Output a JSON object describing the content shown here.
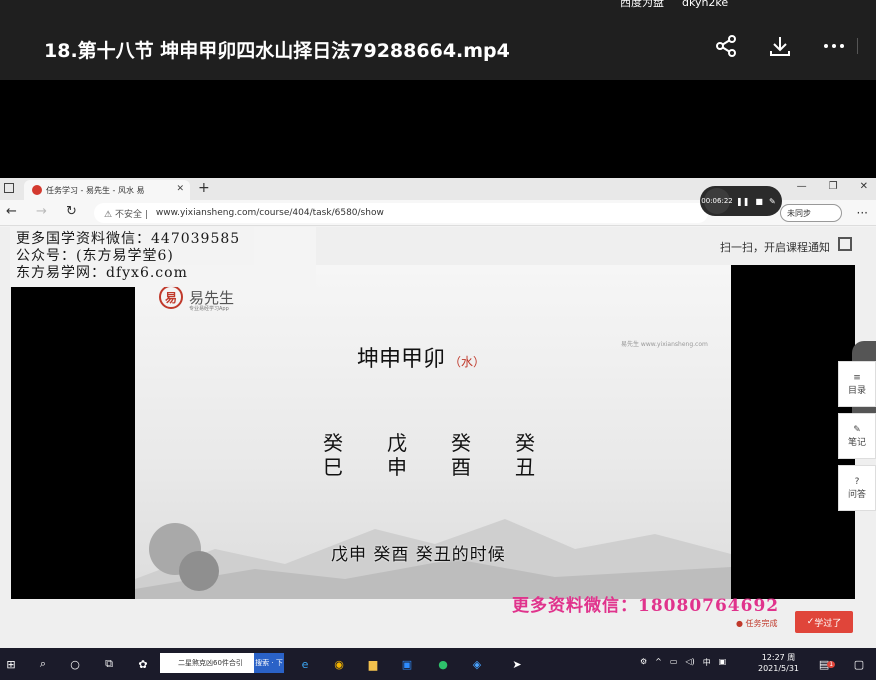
{
  "player": {
    "title": "18.第十八节 坤申甲卯四水山择日法79288664.mp4",
    "top_cut_text": "西度为盘 　 dkyh2ke",
    "icons": [
      "share-icon",
      "download-icon",
      "more-icon"
    ]
  },
  "browser": {
    "tab_title": "任务学习 - 易先生 - 风水 易",
    "insecure_label": "不安全",
    "url": "www.yixiansheng.com/course/404/task/6580/show",
    "recorder_time": "00:06:22",
    "sync_label": "未同步",
    "window_controls": [
      "—",
      "❐",
      "✕"
    ]
  },
  "page": {
    "ad_lines": [
      "更多国学资料微信：447039585",
      "公众号：(东方易学堂6)",
      "东方易学网：dfyx6.com"
    ],
    "scan_text": "扫一扫，开启课程通知",
    "slide": {
      "logo_name": "易先生",
      "logo_sub": "专业易经学习App",
      "title": "坤申甲卯",
      "title_sub": "（水）",
      "watermark": "易先生 www.yixiansheng.com",
      "ganzhi": [
        {
          "stem": "癸",
          "branch": "巳"
        },
        {
          "stem": "戊",
          "branch": "申"
        },
        {
          "stem": "癸",
          "branch": "酉"
        },
        {
          "stem": "癸",
          "branch": "丑"
        }
      ],
      "caption": "戊申  癸酉  癸丑的时候"
    },
    "side_tools": [
      {
        "icon": "menu-icon",
        "label": "目录"
      },
      {
        "icon": "note-icon",
        "label": "笔记"
      },
      {
        "icon": "question-icon",
        "label": "问答"
      }
    ],
    "wechat_ad": "更多资料微信：18080764692",
    "task_done": "任务完成",
    "learned_button": "学过了"
  },
  "taskbar": {
    "search_text": "二星煞克凶60件合引",
    "search_go": "搜索 · 下",
    "ime": "中",
    "time": "12:27 周",
    "date": "2021/5/31",
    "notif_count": "1"
  },
  "colors": {
    "accent_red": "#e0453a",
    "ad_pink": "#e0338c"
  }
}
